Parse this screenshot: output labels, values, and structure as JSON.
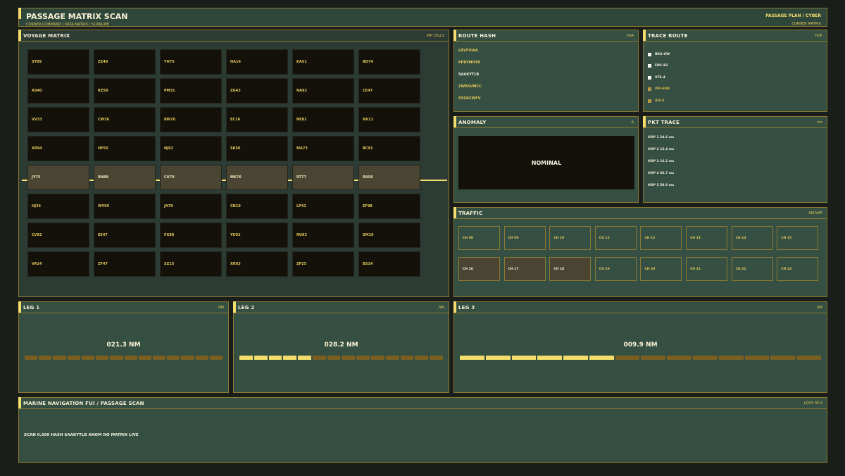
{
  "header": {
    "title": "PASSAGE MATRIX SCAN",
    "breadcrumb": "CORNER COMMAND / DATA MATRIX / SCANLINE",
    "mode": "PASSAGE PLAN / CYBER",
    "submode": "CORNER MATRIX"
  },
  "matrix": {
    "title": "VOYAGE MATRIX",
    "unit": "WP CELLS",
    "highlight_row": 4,
    "rows": [
      [
        "ST89",
        "ZZ48",
        "YH75",
        "HA14",
        "KA51",
        "BD74"
      ],
      [
        "AS40",
        "RZ58",
        "PM31",
        "ZG43",
        "NA92",
        "CE47"
      ],
      [
        "VV33",
        "CW36",
        "BW70",
        "EC16",
        "NE81",
        "NX11"
      ],
      [
        "XR94",
        "HP55",
        "NJ92",
        "SR50",
        "MA73",
        "BC91"
      ],
      [
        "JY75",
        "RN89",
        "CU79",
        "MK76",
        "RT77",
        "RA56"
      ],
      [
        "HJ34",
        "WY95",
        "JA70",
        "CN19",
        "LP41",
        "EF98"
      ],
      [
        "CV92",
        "EE47",
        "FX88",
        "YU92",
        "RU63",
        "SM19"
      ],
      [
        "VA14",
        "ZF47",
        "SZ15",
        "XK63",
        "ZP25",
        "BS14"
      ]
    ]
  },
  "route_hash": {
    "title": "ROUTE HASH",
    "unit": "SHA",
    "items": [
      "LRVFVIAA",
      "PPRYMHYR",
      "SAAKYTLB",
      "ZWRSVMCC",
      "PXSRCWFV"
    ]
  },
  "trace_route": {
    "title": "TRACE ROUTE",
    "unit": "HOP",
    "items": [
      {
        "label": "BRG-GW",
        "on": true
      },
      {
        "label": "ENC-B1",
        "on": true
      },
      {
        "label": "VTS-4",
        "on": true
      },
      {
        "label": "WP-HUB",
        "on": false
      },
      {
        "label": "AIS-S",
        "on": false
      }
    ]
  },
  "anomaly": {
    "title": "ANOMALY",
    "unit": "Δ",
    "value": "NOMINAL"
  },
  "pkt_trace": {
    "title": "PKT TRACE",
    "unit": "ms",
    "items": [
      "HOP 1  24.6 ms",
      "HOP 2  12.4 ms",
      "HOP 3  16.2 ms",
      "HOP 4  36.7 ms",
      "HOP 5  58.9 ms"
    ]
  },
  "traffic": {
    "title": "TRAFFIC",
    "unit": "AIS/VHF",
    "channels": [
      {
        "label": "CH 08",
        "on": false
      },
      {
        "label": "CH 09",
        "on": false
      },
      {
        "label": "CH 10",
        "on": false
      },
      {
        "label": "CH 11",
        "on": false
      },
      {
        "label": "CH 12",
        "on": false
      },
      {
        "label": "CH 13",
        "on": false
      },
      {
        "label": "CH 14",
        "on": false
      },
      {
        "label": "CH 15",
        "on": false
      },
      {
        "label": "CH 16",
        "on": true
      },
      {
        "label": "CH 17",
        "on": true
      },
      {
        "label": "CH 18",
        "on": true
      },
      {
        "label": "CH 19",
        "on": false
      },
      {
        "label": "CH 20",
        "on": false
      },
      {
        "label": "CH 21",
        "on": false
      },
      {
        "label": "CH 22",
        "on": false
      },
      {
        "label": "CH 23",
        "on": false
      }
    ]
  },
  "legs": [
    {
      "title": "LEG 1",
      "unit": "NM",
      "value": "021.3 NM",
      "progress": 0.0,
      "segments": 14
    },
    {
      "title": "LEG 2",
      "unit": "NM",
      "value": "028.2 NM",
      "progress": 0.36,
      "segments": 14
    },
    {
      "title": "LEG 3",
      "unit": "NM",
      "value": "009.9 NM",
      "progress": 0.43,
      "segments": 14
    }
  ],
  "footer": {
    "title": "MARINE NAVIGATION FUI / PASSAGE SCAN",
    "unit": "LOOP 30 S",
    "status": "SCAN 0.560  HASH SAAKYTLB  ANOM NO  MATRIX LIVE"
  },
  "colors": {
    "accent": "#f3dd6b",
    "panel": "#354f42",
    "border": "#8e7a32",
    "cell": "#13110a"
  }
}
